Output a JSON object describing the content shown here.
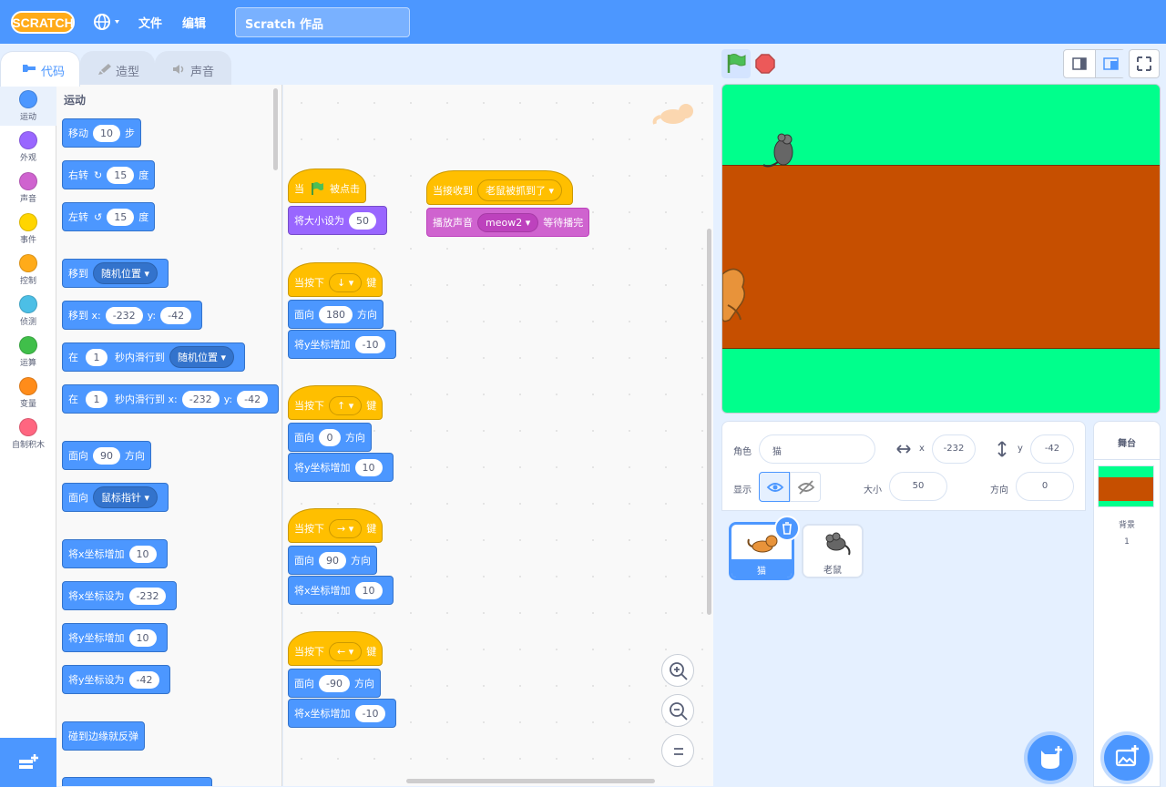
{
  "menu": {
    "file": "文件",
    "edit": "编辑",
    "project_title": "Scratch 作品"
  },
  "tabs": {
    "code": "代码",
    "costumes": "造型",
    "sounds": "声音"
  },
  "categories": [
    {
      "label": "运动",
      "color": "#4c97ff"
    },
    {
      "label": "外观",
      "color": "#9966ff"
    },
    {
      "label": "声音",
      "color": "#cf63cf"
    },
    {
      "label": "事件",
      "color": "#ffd500"
    },
    {
      "label": "控制",
      "color": "#ffab19"
    },
    {
      "label": "侦测",
      "color": "#4cbfe6"
    },
    {
      "label": "运算",
      "color": "#40bf4a"
    },
    {
      "label": "变量",
      "color": "#ff8c1a"
    },
    {
      "label": "自制积木",
      "color": "#ff6680"
    }
  ],
  "palette": {
    "heading": "运动",
    "move": {
      "a": "移动",
      "v": "10",
      "b": "步"
    },
    "turn_right": {
      "a": "右转",
      "v": "15",
      "b": "度"
    },
    "turn_left": {
      "a": "左转",
      "v": "15",
      "b": "度"
    },
    "goto": {
      "a": "移到",
      "dd": "随机位置"
    },
    "goto_xy": {
      "a": "移到 x:",
      "x": "-232",
      "b": "y:",
      "y": "-42"
    },
    "glide": {
      "a": "在",
      "v": "1",
      "b": "秒内滑行到",
      "dd": "随机位置"
    },
    "glide_xy": {
      "a": "在",
      "v": "1",
      "b": "秒内滑行到 x:",
      "x": "-232",
      "c": "y:",
      "y": "-42"
    },
    "point": {
      "a": "面向",
      "v": "90",
      "b": "方向"
    },
    "point_towards": {
      "a": "面向",
      "dd": "鼠标指针"
    },
    "change_x": {
      "a": "将x坐标增加",
      "v": "10"
    },
    "set_x": {
      "a": "将x坐标设为",
      "v": "-232"
    },
    "change_y": {
      "a": "将y坐标增加",
      "v": "10"
    },
    "set_y": {
      "a": "将y坐标设为",
      "v": "-42"
    },
    "bounce": {
      "a": "碰到边缘就反弹"
    }
  },
  "scripts": {
    "flag": {
      "a": "当",
      "b": "被点击",
      "set_size": "将大小设为",
      "size": "50"
    },
    "receive": {
      "a": "当接收到",
      "dd": "老鼠被抓到了",
      "play": "播放声音",
      "sound": "meow2",
      "wait": "等待播完"
    },
    "key_down": {
      "a": "当按下",
      "key": "↓",
      "b": "键",
      "dir_a": "面向",
      "dir": "180",
      "dir_b": "方向",
      "chg": "将y坐标增加",
      "v": "-10"
    },
    "key_up": {
      "a": "当按下",
      "key": "↑",
      "b": "键",
      "dir_a": "面向",
      "dir": "0",
      "dir_b": "方向",
      "chg": "将y坐标增加",
      "v": "10"
    },
    "key_right": {
      "a": "当按下",
      "key": "→",
      "b": "键",
      "dir_a": "面向",
      "dir": "90",
      "dir_b": "方向",
      "chg": "将x坐标增加",
      "v": "10"
    },
    "key_left": {
      "a": "当按下",
      "key": "←",
      "b": "键",
      "dir_a": "面向",
      "dir": "-90",
      "dir_b": "方向",
      "chg": "将x坐标增加",
      "v": "-10"
    }
  },
  "sprite_info": {
    "sprite_label": "角色",
    "sprite_name": "猫",
    "x_label": "x",
    "x": "-232",
    "y_label": "y",
    "y": "-42",
    "show_label": "显示",
    "size_label": "大小",
    "size": "50",
    "direction_label": "方向",
    "direction": "0"
  },
  "sprites": [
    {
      "name": "猫",
      "selected": true
    },
    {
      "name": "老鼠",
      "selected": false
    }
  ],
  "stage_pane": {
    "title": "舞台",
    "backdrops_label": "背景",
    "backdrops_count": "1"
  },
  "colors": {
    "menubar": "#4c97ff",
    "stage_green": "#00ff8c",
    "stage_brown": "#c64f00"
  }
}
